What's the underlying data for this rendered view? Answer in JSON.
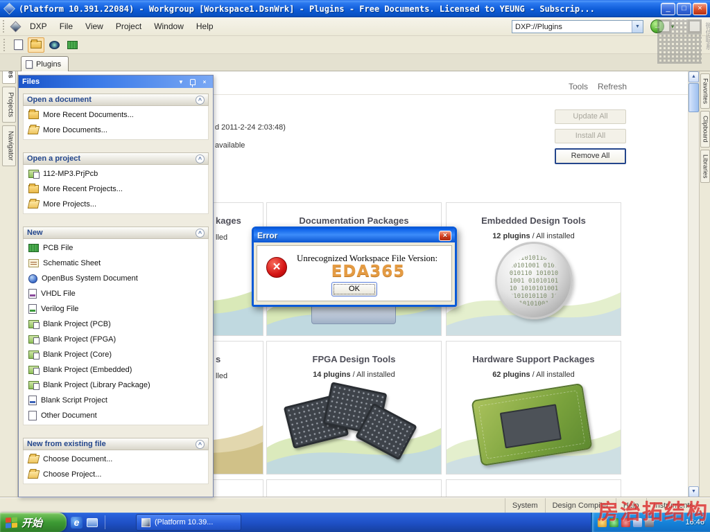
{
  "titlebar": {
    "title": "(Platform 10.391.22084) - Workgroup [Workspace1.DsnWrk] - Plugins - Free Documents. Licensed to YEUNG - Subscrip...",
    "minimize_glyph": "_",
    "restore_glyph": "□",
    "close_glyph": "×"
  },
  "menubar": {
    "app_label": "DXP",
    "items": [
      {
        "label": "File"
      },
      {
        "label": "View"
      },
      {
        "label": "Project"
      },
      {
        "label": "Window"
      },
      {
        "label": "Help"
      }
    ],
    "address_value": "DXP://Plugins",
    "dropdown_glyph": "▼",
    "nav_glyph": "→",
    "nav_small_glyph": "▼"
  },
  "docbar": {
    "tab_label": "Plugins"
  },
  "left_tabs": {
    "files": "Files",
    "projects": "Projects",
    "navigator": "Navigator"
  },
  "right_tabs": {
    "favorites": "Favorites",
    "clipboard": "Clipboard",
    "libraries": "Libraries"
  },
  "files_panel": {
    "title": "Files",
    "chevron_glyph": "▼",
    "close_glyph": "×",
    "collapse_glyph": "^",
    "sections": [
      {
        "title": "Open a document",
        "items": [
          {
            "label": "More Recent Documents..."
          },
          {
            "label": "More Documents..."
          }
        ]
      },
      {
        "title": "Open a project",
        "items": [
          {
            "label": "112-MP3.PrjPcb"
          },
          {
            "label": "More Recent Projects..."
          },
          {
            "label": "More Projects..."
          }
        ]
      },
      {
        "title": "New",
        "items": [
          {
            "label": "PCB File"
          },
          {
            "label": "Schematic Sheet"
          },
          {
            "label": "OpenBus System Document"
          },
          {
            "label": "VHDL File"
          },
          {
            "label": "Verilog File"
          },
          {
            "label": "Blank Project (PCB)"
          },
          {
            "label": "Blank Project (FPGA)"
          },
          {
            "label": "Blank Project (Core)"
          },
          {
            "label": "Blank Project (Embedded)"
          },
          {
            "label": "Blank Project (Library Package)"
          },
          {
            "label": "Blank Script Project"
          },
          {
            "label": "Other Document"
          }
        ]
      },
      {
        "title": "New from existing file",
        "items": [
          {
            "label": "Choose Document..."
          },
          {
            "label": "Choose Project..."
          }
        ]
      }
    ]
  },
  "plugins_page": {
    "tools_label": "Tools",
    "refresh_label": "Refresh",
    "info_line1": "d 2011-2-24 2:03:48)",
    "info_line2": "available",
    "update_all": "Update All",
    "install_all": "Install All",
    "remove_all": "Remove All",
    "cards": {
      "cut_top": {
        "title_fragment": "kages",
        "subtitle_fragment": "lled"
      },
      "documentation": {
        "title": "Documentation Packages"
      },
      "embedded": {
        "title": "Embedded Design Tools",
        "count": "12 plugins",
        "installed": " / All installed",
        "binary": "0101010110 1010101001 0101010110 1010101001 0101010110 1010101001 0101010110 1010101001"
      },
      "cut_bottom": {
        "title_fragment": "s",
        "subtitle_fragment": "lled"
      },
      "fpga": {
        "title": "FPGA Design Tools",
        "count": "14 plugins",
        "installed": " / All installed"
      },
      "hardware": {
        "title": "Hardware Support Packages",
        "count": "62 plugins",
        "installed": " / All installed"
      }
    }
  },
  "scrollbar": {
    "up_glyph": "▲",
    "down_glyph": "▼"
  },
  "error_dialog": {
    "title": "Error",
    "close_glyph": "×",
    "icon_glyph": "×",
    "message": "Unrecognized Workspace File Version:",
    "watermark": "EDA365",
    "ok_label": "OK"
  },
  "status_bar": {
    "items": [
      {
        "label": "System"
      },
      {
        "label": "Design Compiler"
      },
      {
        "label": "Help"
      },
      {
        "label": "Instruments"
      }
    ]
  },
  "taskbar": {
    "start_label": "开始",
    "ie_glyph": "e",
    "task_label": "(Platform 10.39...",
    "time": "16:46"
  },
  "watermarks": {
    "qr_caption": "微信联系",
    "red_text": "房治拓结构"
  }
}
